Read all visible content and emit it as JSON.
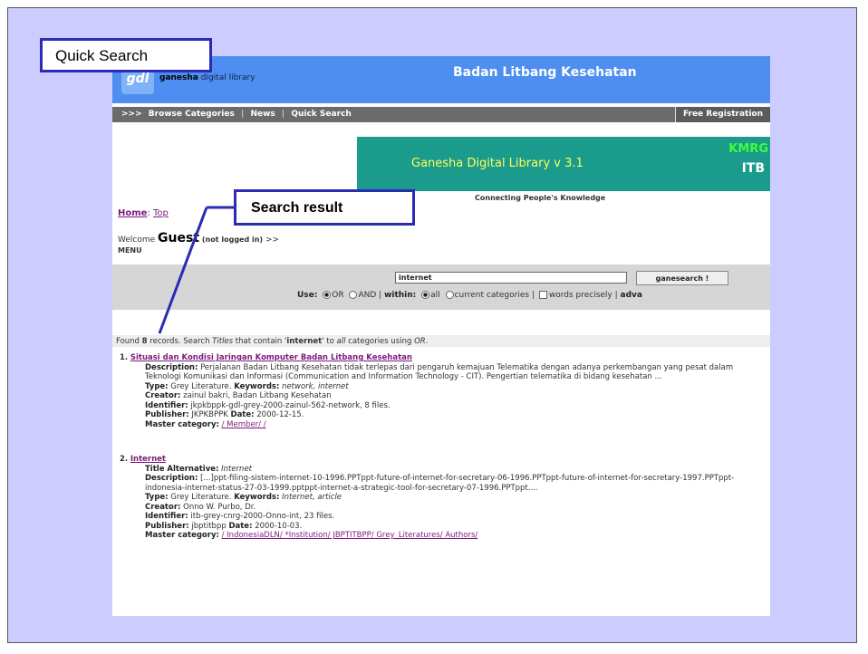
{
  "callouts": {
    "quick_search": "Quick Search",
    "search_result": "Search result"
  },
  "header": {
    "logo_mark": "gdl",
    "logo_bold": "ganesha",
    "logo_rest": " digital library",
    "title": "Badan Litbang Kesehatan"
  },
  "nav": {
    "prefix": ">>>",
    "items": [
      "Browse Categories",
      "News",
      "Quick Search"
    ],
    "separator": "|",
    "register": "Free Registration"
  },
  "banner": {
    "title": "Ganesha Digital Library v 3.1",
    "org1": "KMRG",
    "org2": "ITB",
    "tagline": "Connecting People's Knowledge"
  },
  "breadcrumb": {
    "home": "Home",
    "sep": ":",
    "top": "Top"
  },
  "welcome": {
    "prefix": "Welcome ",
    "user": "Guest",
    "status": "(not logged in)",
    "arrow": ">>",
    "menu": "MENU"
  },
  "search": {
    "query": "internet",
    "button": "ganesearch !",
    "use_label": "Use:",
    "opt_or": "OR",
    "opt_and": "AND",
    "within_label": "within:",
    "opt_all": "all",
    "opt_current": "current categories",
    "opt_words": "words precisely",
    "advanced": "adva"
  },
  "summary": {
    "p1": "Found ",
    "count": "8",
    "p2": " records. Search ",
    "titles": "Titles",
    "p3": " that contain '",
    "term": "internet",
    "p4": "' to ",
    "all": "all",
    "p5": " categories using ",
    "op": "OR",
    "p6": "."
  },
  "results": [
    {
      "num": "1.",
      "title": "Situasi dan Kondisi Jaringan Komputer Badan Litbang Kesehatan",
      "description": "Perjalanan Badan Litbang Kesehatan tidak terlepas dari pengaruh kemajuan Telematika dengan adanya perkembangan yang pesat dalam Teknologi Komunikasi dan Informasi (Communication and Information Technology - CIT). Pengertian telematika di bidang kesehatan ...",
      "type": "Grey Literature.",
      "keywords": "network, internet",
      "creator": "zainul bakri, Badan Litbang Kesehatan",
      "identifier": "jkpkbppk-gdl-grey-2000-zainul-562-network, 8 files.",
      "publisher": "JKPKBPPK",
      "date": "2000-12-15.",
      "category": "/ Member/ /"
    },
    {
      "num": "2.",
      "title": "Internet",
      "title_alt": "Internet",
      "description": "[...]ppt-filing-sistem-internet-10-1996.PPTppt-future-of-internet-for-secretary-06-1996.PPTppt-future-of-internet-for-secretary-1997.PPTppt-indonesia-internet-status-27-03-1999.pptppt-internet-a-strategic-tool-for-secretary-07-1996.PPTppt....",
      "type": "Grey Literature.",
      "keywords": "Internet, article",
      "creator": "Onno W. Purbo, Dr.",
      "identifier": "itb-grey-cnrg-2000-Onno-int, 23 files.",
      "publisher": "jbptitbpp",
      "date": "2000-10-03.",
      "category": "/ IndonesiaDLN/ *Institution/ JBPTITBPP/ Grey_Literatures/ Authors/"
    }
  ],
  "labels": {
    "title_alt": "Title Alternative:",
    "description": "Description:",
    "type": "Type:",
    "keywords": "Keywords:",
    "creator": "Creator:",
    "identifier": "Identifier:",
    "publisher": "Publisher:",
    "date": "Date:",
    "category": "Master category:"
  },
  "colors": {
    "slide_bg": "#ccccff",
    "callout_border": "#2b2bb5",
    "header_blue": "#4e8ef0",
    "banner_teal": "#1a9b8c",
    "link_purple": "#7a1b7a"
  }
}
